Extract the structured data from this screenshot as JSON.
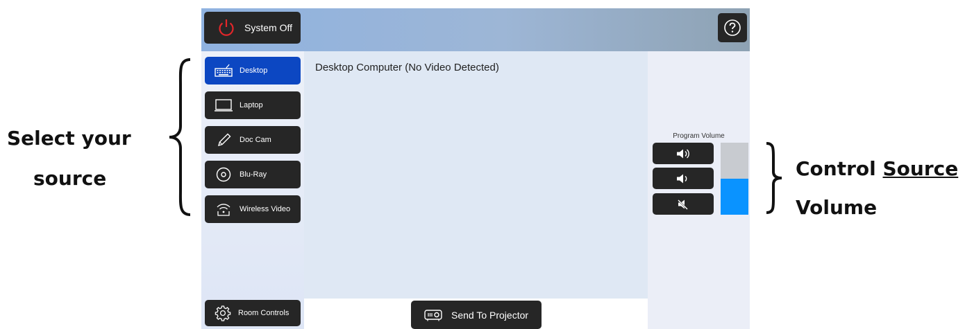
{
  "header": {
    "system_off_label": "System Off",
    "help_icon": "help-icon"
  },
  "sources": {
    "items": [
      {
        "label": "Desktop",
        "icon": "keyboard-icon",
        "active": true
      },
      {
        "label": "Laptop",
        "icon": "laptop-icon",
        "active": false
      },
      {
        "label": "Doc Cam",
        "icon": "pencil-icon",
        "active": false
      },
      {
        "label": "Blu-Ray",
        "icon": "disc-icon",
        "active": false
      },
      {
        "label": "Wireless Video",
        "icon": "wireless-icon",
        "active": false
      }
    ]
  },
  "main": {
    "title": "Desktop Computer (No Video Detected)"
  },
  "footer": {
    "room_controls_label": "Room Controls",
    "send_label": "Send To Projector"
  },
  "volume": {
    "label": "Program Volume",
    "level": 0.5,
    "buttons": [
      "volume-up-icon",
      "volume-down-icon",
      "mute-icon"
    ],
    "fill_color": "#0a93ff"
  },
  "annotations": {
    "left_line1": "Select your",
    "left_line2": "source",
    "right_line1": "Control",
    "right_underlined": "Source",
    "right_line2": "Volume"
  },
  "colors": {
    "active_source": "#0c47c2",
    "button_dark": "#262626",
    "power_red": "#e3262a"
  }
}
